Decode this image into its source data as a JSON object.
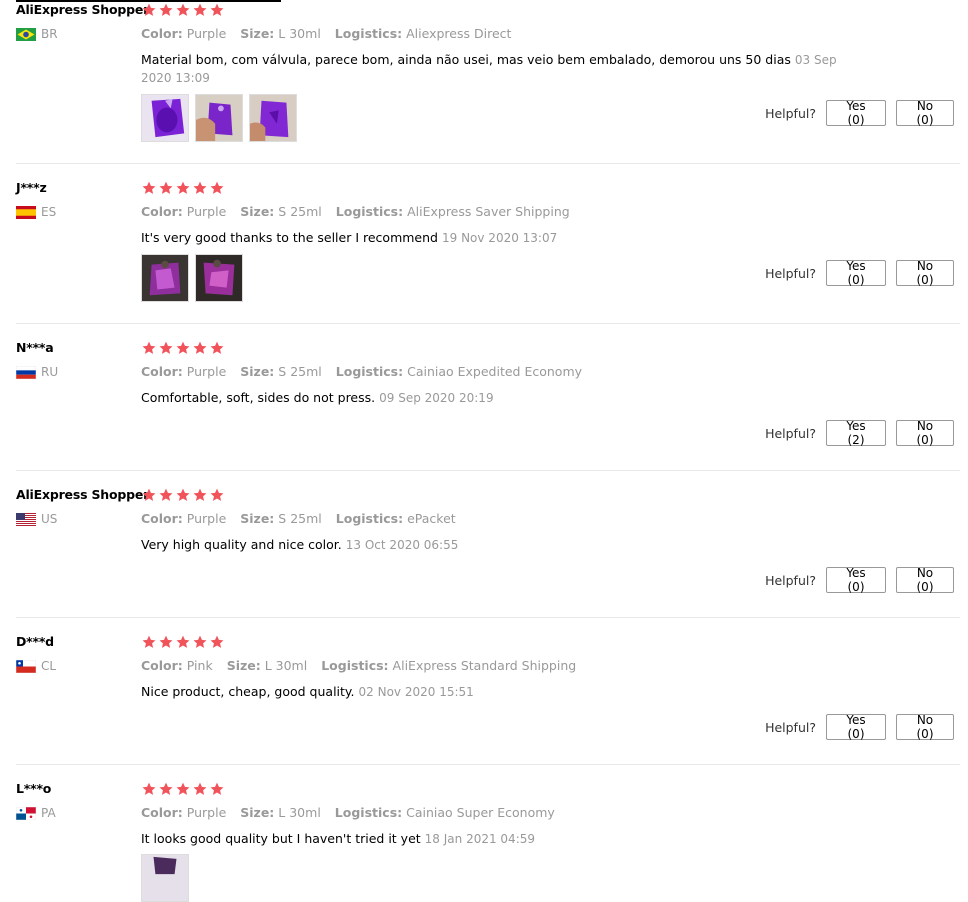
{
  "helpful_label": "Helpful?",
  "labels": {
    "color": "Color:",
    "size": "Size:",
    "logistics": "Logistics:"
  },
  "reviews": [
    {
      "user": "AliExpress Shopper",
      "country": "BR",
      "color": "Purple",
      "size": "L 30ml",
      "logistics": "Aliexpress Direct",
      "text": "Material bom, com válvula, parece bom, ainda não usei, mas veio bem embalado, demorou uns 50 dias",
      "date": "03 Sep 2020 13:09",
      "yes": "Yes (0)",
      "no": "No (0)"
    },
    {
      "user": "J***z",
      "country": "ES",
      "color": "Purple",
      "size": "S 25ml",
      "logistics": "AliExpress Saver Shipping",
      "text": "It's very good thanks to the seller I recommend",
      "date": "19 Nov 2020 13:07",
      "yes": "Yes (0)",
      "no": "No (0)"
    },
    {
      "user": "N***a",
      "country": "RU",
      "color": "Purple",
      "size": "S 25ml",
      "logistics": "Cainiao Expedited Economy",
      "text": "Comfortable, soft, sides do not press.",
      "date": "09 Sep 2020 20:19",
      "yes": "Yes (2)",
      "no": "No (0)"
    },
    {
      "user": "AliExpress Shopper",
      "country": "US",
      "color": "Purple",
      "size": "S 25ml",
      "logistics": "ePacket",
      "text": "Very high quality and nice color.",
      "date": "13 Oct 2020 06:55",
      "yes": "Yes (0)",
      "no": "No (0)"
    },
    {
      "user": "D***d",
      "country": "CL",
      "color": "Pink",
      "size": "L 30ml",
      "logistics": "AliExpress Standard Shipping",
      "text": "Nice product, cheap, good quality.",
      "date": "02 Nov 2020 15:51",
      "yes": "Yes (0)",
      "no": "No (0)"
    },
    {
      "user": "L***o",
      "country": "PA",
      "color": "Purple",
      "size": "L 30ml",
      "logistics": "Cainiao Super Economy",
      "text": "It looks good quality but I haven't tried it yet",
      "date": "18 Jan 2021 04:59"
    }
  ],
  "colors": {
    "star": "#f0535a",
    "muted": "#999999",
    "purple": "#8a2be2"
  },
  "star_rating": 5
}
